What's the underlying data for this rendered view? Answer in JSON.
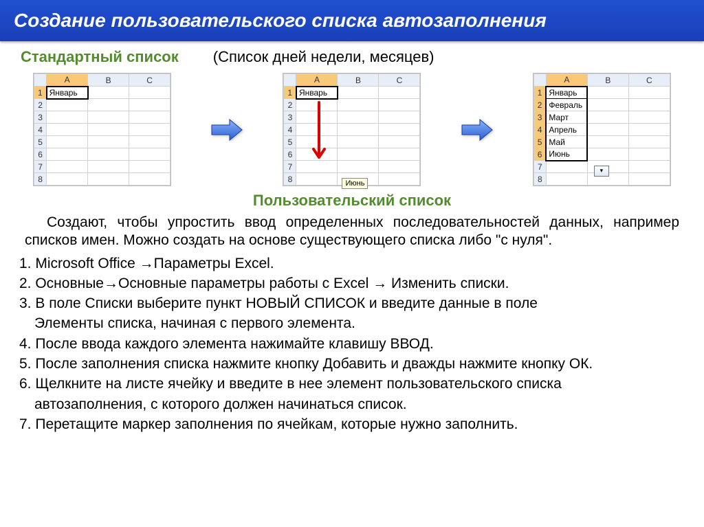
{
  "title": "Создание пользовательского списка автозаполнения",
  "subtitle_green": "Стандартный список",
  "subtitle_black": "(Список дней недели, месяцев)",
  "columns": {
    "corner": "",
    "A": "A",
    "B": "B",
    "C": "C"
  },
  "rows": [
    "1",
    "2",
    "3",
    "4",
    "5",
    "6",
    "7",
    "8"
  ],
  "sheet1": {
    "A1": "Январь"
  },
  "sheet2": {
    "A1": "Январь",
    "tooltip": "Июнь"
  },
  "sheet3": {
    "A1": "Январь",
    "A2": "Февраль",
    "A3": "Март",
    "A4": "Апрель",
    "A5": "Май",
    "A6": "Июнь"
  },
  "custom_title": "Пользовательский  список",
  "paragraph": "Создают, чтобы упростить ввод определенных последовательностей данных, например списков имен.  Можно создать на основе существующего списка либо \"с нуля\".",
  "steps": {
    "s1": "1. Microsoft Office →Параметры Excel.",
    "s2": "2. Основные→Основные параметры работы с Excel → Изменить списки.",
    "s3a": "3. В поле Списки выберите пункт НОВЫЙ СПИСОК и введите данные в поле",
    "s3b": "Элементы списка, начиная с первого элемента.",
    "s4": "4. После ввода каждого элемента нажимайте клавишу ВВОД.",
    "s5": "5. После заполнения списка нажмите кнопку Добавить и дважды нажмите кнопку ОК.",
    "s6a": "6. Щелкните на листе ячейку и введите в нее элемент пользовательского списка",
    "s6b": "автозаполнения, с которого должен начинаться список.",
    "s7": "7. Перетащите маркер заполнения по ячейкам, которые нужно заполнить."
  }
}
